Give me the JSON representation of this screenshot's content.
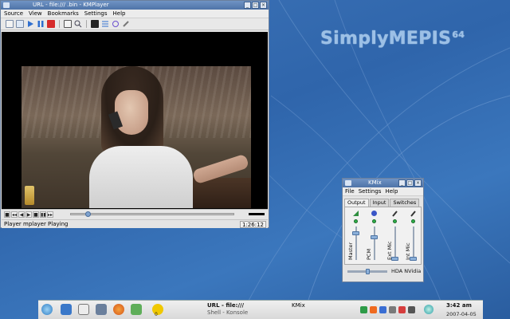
{
  "desktop": {
    "brand_text": "SimplyMEPIS",
    "brand_sup": "64",
    "bg_color": "#3467ad"
  },
  "kmplayer": {
    "title": "URL - file:///                    .bin - KMPlayer",
    "menu": [
      "Source",
      "View",
      "Bookmarks",
      "Settings",
      "Help"
    ],
    "toolbar_icons": [
      "open-icon",
      "open-url-icon",
      "play-icon",
      "pause-icon",
      "stop-icon",
      "fullscreen-icon",
      "zoom-icon",
      "console-icon",
      "playlist-icon",
      "sync-icon",
      "config-icon"
    ],
    "controls": [
      "■",
      "◂◂",
      "◀",
      "▶",
      "■",
      "▮▮",
      "▸▸"
    ],
    "seek_progress": 0.09,
    "status": "Player mplayer Playing",
    "time": "1:26:12"
  },
  "kmix": {
    "title": "KMix",
    "menu": [
      "File",
      "Settings",
      "Help"
    ],
    "tabs": [
      "Output",
      "Input",
      "Switches"
    ],
    "active_tab": "Output",
    "channels": [
      {
        "label": "Master",
        "level": 0.85
      },
      {
        "label": "PCM",
        "level": 0.7
      },
      {
        "label": "Ext Mic",
        "level": 0.0
      },
      {
        "label": "Int Mic",
        "level": 0.0
      }
    ],
    "balance": 0.5,
    "hardware": "HDA NVidia"
  },
  "taskbar": {
    "task1": "URL - file:///",
    "task2": "Shell - Konsole",
    "task_kmix": "KMix",
    "counter": "0",
    "clock": "3:42 am",
    "date": "2007-04-05"
  }
}
